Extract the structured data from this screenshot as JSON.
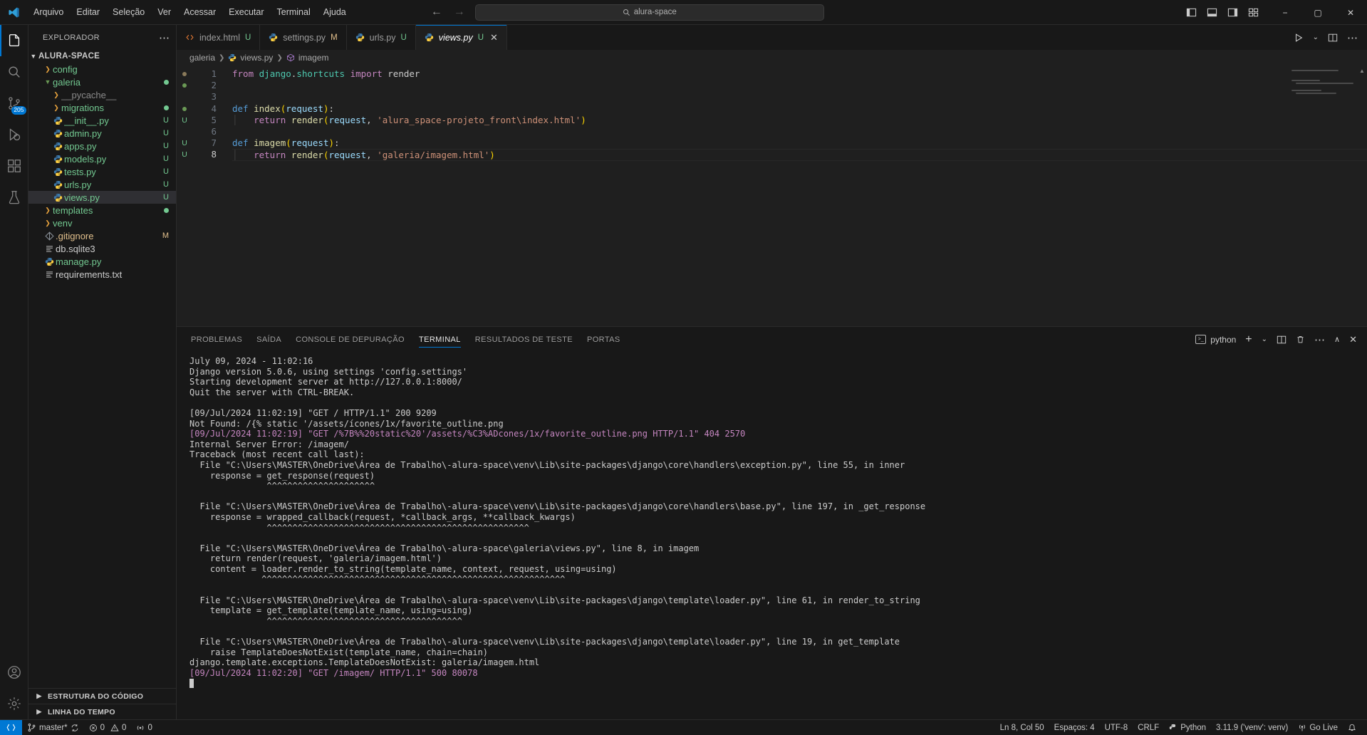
{
  "titlebar": {
    "logo_icon": "vscode-logo-icon",
    "menus": [
      "Arquivo",
      "Editar",
      "Seleção",
      "Ver",
      "Acessar",
      "Executar",
      "Terminal",
      "Ajuda"
    ],
    "nav_back_icon": "arrow-left-icon",
    "nav_forward_icon": "arrow-right-icon",
    "search": {
      "icon": "search-icon",
      "value": "alura-space"
    },
    "layout_icons": [
      "toggle-primary-sidebar-icon",
      "toggle-panel-icon",
      "toggle-secondary-sidebar-icon",
      "customize-layout-icon"
    ],
    "window_controls": {
      "minimize": "−",
      "maximize": "▢",
      "close": "✕"
    }
  },
  "activitybar": {
    "items": [
      {
        "name": "explorer",
        "icon": "files-icon",
        "active": true,
        "badge": ""
      },
      {
        "name": "search",
        "icon": "search-icon",
        "active": false,
        "badge": ""
      },
      {
        "name": "source-control",
        "icon": "source-control-icon",
        "active": false,
        "badge": "205"
      },
      {
        "name": "run-and-debug",
        "icon": "run-debug-icon",
        "active": false,
        "badge": ""
      },
      {
        "name": "extensions",
        "icon": "extensions-icon",
        "active": false,
        "badge": ""
      },
      {
        "name": "testing",
        "icon": "beaker-icon",
        "active": false,
        "badge": ""
      }
    ],
    "bottom": [
      {
        "name": "accounts",
        "icon": "account-icon"
      },
      {
        "name": "manage",
        "icon": "gear-icon"
      }
    ]
  },
  "sidebar": {
    "title": "EXPLORADOR",
    "more_icon": "ellipsis-icon",
    "root": {
      "label": "ALURA-SPACE",
      "expanded": true
    },
    "tree": [
      {
        "label": "config",
        "type": "folder",
        "expanded": false,
        "indent": 1,
        "badge": "",
        "dot": ""
      },
      {
        "label": "galeria",
        "type": "folder",
        "expanded": true,
        "indent": 1,
        "badge": "",
        "dot": "green"
      },
      {
        "label": "__pycache__",
        "type": "folder",
        "expanded": false,
        "indent": 2,
        "badge": "",
        "dot": "",
        "muted": true
      },
      {
        "label": "migrations",
        "type": "folder",
        "expanded": false,
        "indent": 2,
        "badge": "",
        "dot": "green"
      },
      {
        "label": "__init__.py",
        "type": "python",
        "indent": 2,
        "badge": "U",
        "dot": ""
      },
      {
        "label": "admin.py",
        "type": "python",
        "indent": 2,
        "badge": "U",
        "dot": ""
      },
      {
        "label": "apps.py",
        "type": "python",
        "indent": 2,
        "badge": "U",
        "dot": ""
      },
      {
        "label": "models.py",
        "type": "python",
        "indent": 2,
        "badge": "U",
        "dot": ""
      },
      {
        "label": "tests.py",
        "type": "python",
        "indent": 2,
        "badge": "U",
        "dot": ""
      },
      {
        "label": "urls.py",
        "type": "python",
        "indent": 2,
        "badge": "U",
        "dot": ""
      },
      {
        "label": "views.py",
        "type": "python",
        "indent": 2,
        "badge": "U",
        "dot": "",
        "selected": true
      },
      {
        "label": "templates",
        "type": "folder",
        "expanded": false,
        "indent": 1,
        "badge": "",
        "dot": "green"
      },
      {
        "label": "venv",
        "type": "folder",
        "expanded": false,
        "indent": 1,
        "badge": "",
        "dot": ""
      },
      {
        "label": ".gitignore",
        "type": "git",
        "indent": 1,
        "badge": "M",
        "dot": ""
      },
      {
        "label": "db.sqlite3",
        "type": "file",
        "indent": 1,
        "badge": "",
        "dot": ""
      },
      {
        "label": "manage.py",
        "type": "python",
        "indent": 1,
        "badge": "",
        "dot": ""
      },
      {
        "label": "requirements.txt",
        "type": "file",
        "indent": 1,
        "badge": "",
        "dot": ""
      }
    ],
    "sections": [
      {
        "label": "ESTRUTURA DO CÓDIGO",
        "expanded": false
      },
      {
        "label": "LINHA DO TEMPO",
        "expanded": false
      }
    ]
  },
  "editor": {
    "tabs": [
      {
        "label": "index.html",
        "badge": "U",
        "icon": "html-icon",
        "active": false,
        "dirty": false
      },
      {
        "label": "settings.py",
        "badge": "M",
        "icon": "python-icon",
        "active": false,
        "dirty": false
      },
      {
        "label": "urls.py",
        "badge": "U",
        "icon": "python-icon",
        "active": false,
        "dirty": false
      },
      {
        "label": "views.py",
        "badge": "U",
        "icon": "python-icon",
        "active": true,
        "dirty": false
      }
    ],
    "tab_actions": [
      "run-python-file-icon",
      "chevron-down-icon",
      "split-editor-icon",
      "more-actions-icon"
    ],
    "breadcrumb": [
      "galeria",
      "views.py",
      "imagem"
    ],
    "breadcrumb_icons": [
      "",
      "python-icon",
      "symbol-method-icon"
    ],
    "gutter": [
      {
        "line": 1,
        "mark": "dot-brown"
      },
      {
        "line": 2,
        "mark": "dot-green"
      },
      {
        "line": 3,
        "mark": ""
      },
      {
        "line": 4,
        "mark": "dot-green"
      },
      {
        "line": 5,
        "mark": "U"
      },
      {
        "line": 6,
        "mark": ""
      },
      {
        "line": 7,
        "mark": "U"
      },
      {
        "line": 8,
        "mark": "U"
      }
    ],
    "line_numbers": [
      "1",
      "2",
      "3",
      "4",
      "5",
      "6",
      "7",
      "8"
    ],
    "current_line": 8,
    "code": [
      "from django.shortcuts import render",
      "",
      "",
      "def index(request):",
      "    return render(request, 'alura_space-projeto_front\\index.html')",
      "",
      "def imagem(request):",
      "    return render(request, 'galeria/imagem.html')"
    ]
  },
  "panel": {
    "tabs": [
      "PROBLEMAS",
      "SAÍDA",
      "CONSOLE DE DEPURAÇÃO",
      "TERMINAL",
      "RESULTADOS DE TESTE",
      "PORTAS"
    ],
    "active_tab": "TERMINAL",
    "terminal_name": "python",
    "actions": [
      "new-terminal-icon",
      "chevron-down-icon",
      "split-terminal-icon",
      "kill-terminal-icon",
      "more-actions-icon",
      "maximize-panel-icon",
      "close-panel-icon"
    ],
    "output": [
      {
        "text": "July 09, 2024 - 11:02:16",
        "color": "white"
      },
      {
        "text": "Django version 5.0.6, using settings 'config.settings'",
        "color": "white"
      },
      {
        "text": "Starting development server at http://127.0.0.1:8000/",
        "color": "white"
      },
      {
        "text": "Quit the server with CTRL-BREAK.",
        "color": "white"
      },
      {
        "text": "",
        "color": "white"
      },
      {
        "text": "[09/Jul/2024 11:02:19] \"GET / HTTP/1.1\" 200 9209",
        "color": "white"
      },
      {
        "text": "Not Found: /{% static '/assets/ícones/1x/favorite_outline.png",
        "color": "white"
      },
      {
        "text": "[09/Jul/2024 11:02:19] \"GET /%7B%%20static%20'/assets/%C3%ADcones/1x/favorite_outline.png HTTP/1.1\" 404 2570",
        "color": "magenta"
      },
      {
        "text": "Internal Server Error: /imagem/",
        "color": "white"
      },
      {
        "text": "Traceback (most recent call last):",
        "color": "white"
      },
      {
        "text": "  File \"C:\\Users\\MASTER\\OneDrive\\Área de Trabalho\\-alura-space\\venv\\Lib\\site-packages\\django\\core\\handlers\\exception.py\", line 55, in inner",
        "color": "white"
      },
      {
        "text": "    response = get_response(request)",
        "color": "white"
      },
      {
        "text": "               ^^^^^^^^^^^^^^^^^^^^^",
        "color": "white"
      },
      {
        "text": "",
        "color": "white"
      },
      {
        "text": "  File \"C:\\Users\\MASTER\\OneDrive\\Área de Trabalho\\-alura-space\\venv\\Lib\\site-packages\\django\\core\\handlers\\base.py\", line 197, in _get_response",
        "color": "white"
      },
      {
        "text": "    response = wrapped_callback(request, *callback_args, **callback_kwargs)",
        "color": "white"
      },
      {
        "text": "               ^^^^^^^^^^^^^^^^^^^^^^^^^^^^^^^^^^^^^^^^^^^^^^^^^^^",
        "color": "white"
      },
      {
        "text": "",
        "color": "white"
      },
      {
        "text": "  File \"C:\\Users\\MASTER\\OneDrive\\Área de Trabalho\\-alura-space\\galeria\\views.py\", line 8, in imagem",
        "color": "white"
      },
      {
        "text": "    return render(request, 'galeria/imagem.html')",
        "color": "white"
      },
      {
        "text": "    content = loader.render_to_string(template_name, context, request, using=using)",
        "color": "white"
      },
      {
        "text": "              ^^^^^^^^^^^^^^^^^^^^^^^^^^^^^^^^^^^^^^^^^^^^^^^^^^^^^^^^^^^",
        "color": "white"
      },
      {
        "text": "",
        "color": "white"
      },
      {
        "text": "  File \"C:\\Users\\MASTER\\OneDrive\\Área de Trabalho\\-alura-space\\venv\\Lib\\site-packages\\django\\template\\loader.py\", line 61, in render_to_string",
        "color": "white"
      },
      {
        "text": "    template = get_template(template_name, using=using)",
        "color": "white"
      },
      {
        "text": "               ^^^^^^^^^^^^^^^^^^^^^^^^^^^^^^^^^^^^^^",
        "color": "white"
      },
      {
        "text": "",
        "color": "white"
      },
      {
        "text": "  File \"C:\\Users\\MASTER\\OneDrive\\Área de Trabalho\\-alura-space\\venv\\Lib\\site-packages\\django\\template\\loader.py\", line 19, in get_template",
        "color": "white"
      },
      {
        "text": "    raise TemplateDoesNotExist(template_name, chain=chain)",
        "color": "white"
      },
      {
        "text": "django.template.exceptions.TemplateDoesNotExist: galeria/imagem.html",
        "color": "white"
      },
      {
        "text": "[09/Jul/2024 11:02:20] \"GET /imagem/ HTTP/1.1\" 500 80078",
        "color": "magenta"
      }
    ]
  },
  "statusbar": {
    "remote_icon": "remote-window-icon",
    "branch": {
      "icon": "source-control-icon",
      "label": "master*",
      "sync_icon": "sync-icon"
    },
    "errors": {
      "icon": "error-icon",
      "count": "0"
    },
    "warnings": {
      "icon": "warning-icon",
      "count": "0"
    },
    "ports": {
      "icon": "radio-tower-icon",
      "count": "0"
    },
    "right": [
      {
        "name": "editor-position",
        "label": "Ln 8, Col 50"
      },
      {
        "name": "indentation",
        "label": "Espaços: 4"
      },
      {
        "name": "encoding",
        "label": "UTF-8"
      },
      {
        "name": "eol",
        "label": "CRLF"
      },
      {
        "name": "language-mode",
        "label": "Python",
        "icon": "python-icon"
      },
      {
        "name": "python-interpreter",
        "label": "3.11.9 ('venv': venv)"
      },
      {
        "name": "go-live",
        "label": "Go Live",
        "icon": "broadcast-icon"
      },
      {
        "name": "notifications",
        "label": "",
        "icon": "bell-icon"
      }
    ]
  },
  "colors": {
    "accent": "#0078d4",
    "bg": "#1f1f1f",
    "chrome": "#181818",
    "green": "#73c991",
    "orange": "#e2c08d",
    "magenta": "#c586c0"
  }
}
